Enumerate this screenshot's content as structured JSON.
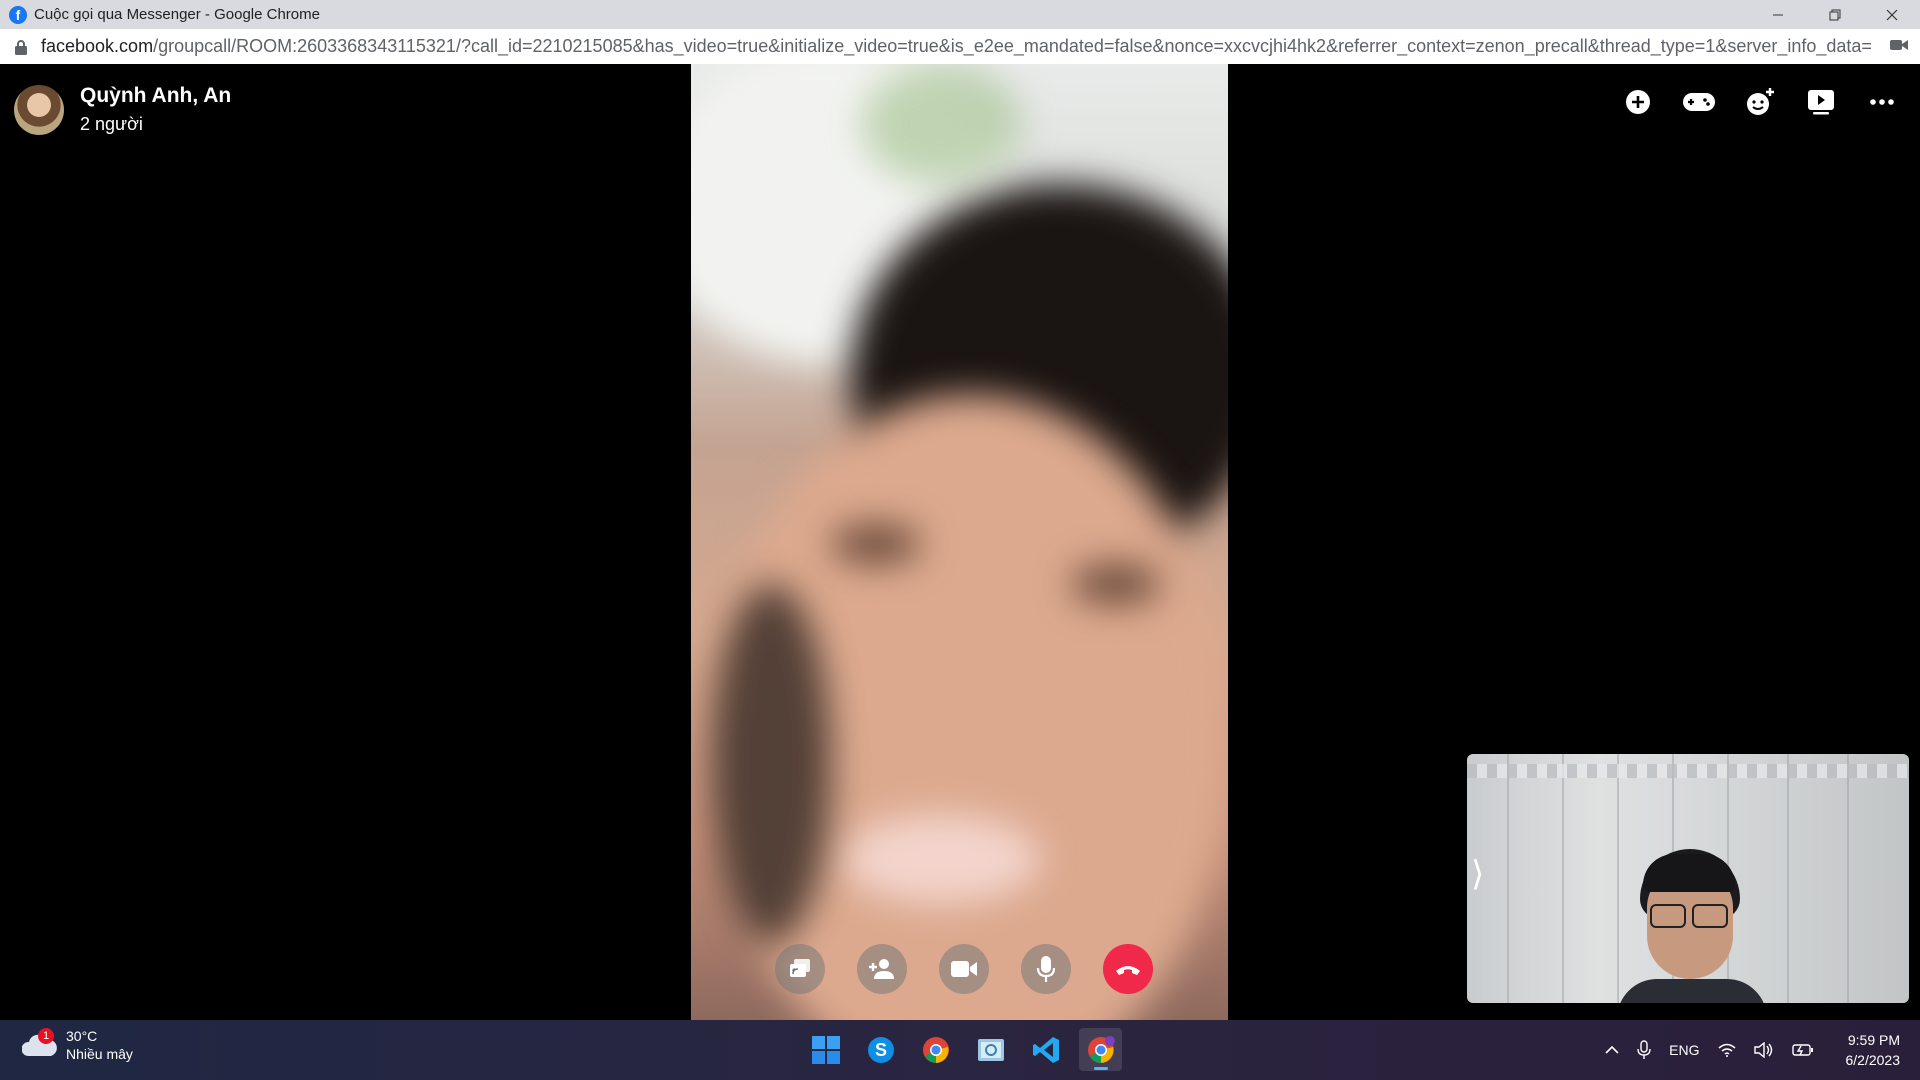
{
  "window": {
    "title": "Cuộc gọi qua Messenger - Google Chrome",
    "fb_logo": "f"
  },
  "address": {
    "domain": "facebook.com",
    "path": "/groupcall/ROOM:2603368343115321/?call_id=2210215085&has_video=true&initialize_video=true&is_e2ee_mandated=false&nonce=xxcvcjhi4hk2&referrer_context=zenon_precall&thread_type=1&server_info_data=GAN..."
  },
  "call": {
    "name": "Quỳnh Anh, An",
    "participants": "2 người",
    "header_icons": [
      "add-icon",
      "game-icon",
      "add-emoji-icon",
      "play-icon",
      "more-icon"
    ],
    "controls": [
      "share-screen-icon",
      "add-person-icon",
      "video-camera-icon",
      "microphone-icon",
      "end-call-icon"
    ],
    "end_call_color": "#f02849",
    "self_view_chevron": "⟩"
  },
  "taskbar": {
    "weather_badge": "1",
    "temperature": "30°C",
    "condition": "Nhiều mây",
    "apps": [
      "windows-start-icon",
      "skype-icon",
      "chrome-icon",
      "app-icon",
      "vscode-icon",
      "chrome-profile-icon"
    ],
    "language": "ENG",
    "time": "9:59 PM",
    "date": "6/2/2023"
  }
}
